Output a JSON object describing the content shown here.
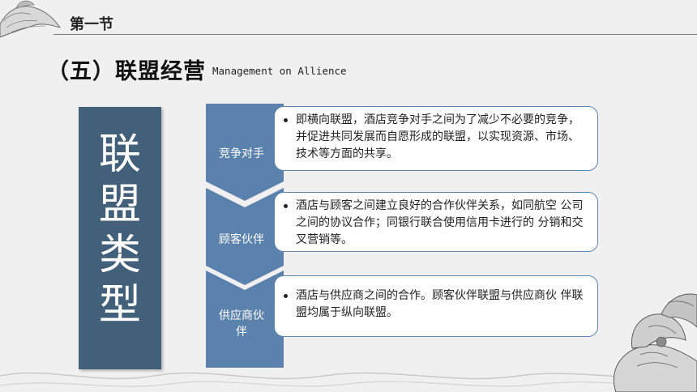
{
  "header": {
    "section": "第一节"
  },
  "title": {
    "main": "（五）联盟经营",
    "sub": "Management on Allience"
  },
  "side_label": [
    "联",
    "盟",
    "类",
    "型"
  ],
  "items": [
    {
      "label": "竞争对手",
      "text": "即横向联盟，酒店竞争对手之间为了减少不必要的竞争，并促进共同发展而自愿形成的联盟，以实现资源、市场、技术等方面的共享。"
    },
    {
      "label": "顾客伙伴",
      "text": "酒店与顾客之间建立良好的合作伙伴关系，如同航空 公司之间的协议合作；同银行联合使用信用卡进行的 分销和交叉营销等。"
    },
    {
      "label_line1": "供应商伙",
      "label_line2": "伴",
      "text": "酒店与供应商之间的合作。顾客伙伴联盟与供应商伙 伴联盟均属于纵向联盟。"
    }
  ],
  "colors": {
    "accent": "#43607a",
    "chevron": "#5b82ac",
    "card_border": "#5e86ae"
  }
}
